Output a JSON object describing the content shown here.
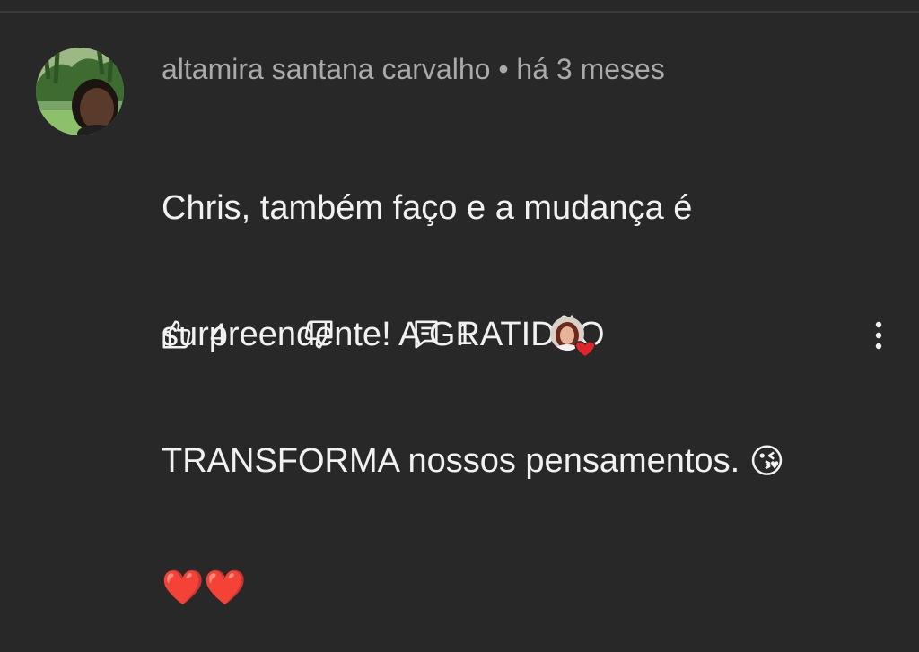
{
  "comment": {
    "author": "altamira santana carvalho",
    "separator": "•",
    "time": "há 3 meses",
    "line1": "Chris, também faço e a mudança é",
    "line2": "surpreendente! A GRATIDÃO",
    "line3": "TRANSFORMA nossos pensamentos.",
    "emoji_kiss": "😘",
    "emoji_hearts": "❤️❤️"
  },
  "actions": {
    "like_count": "4",
    "reply_count": "1"
  },
  "icons": {
    "avatar": "avatar-icon",
    "like": "thumbs-up-icon",
    "dislike": "thumbs-down-icon",
    "reply": "reply-icon",
    "creator_heart": "creator-heart-icon",
    "more": "more-vert-icon"
  },
  "colors": {
    "background": "#282828",
    "text": "#f1f1f1",
    "meta": "#aaaaaa",
    "heart": "#e0242c"
  }
}
